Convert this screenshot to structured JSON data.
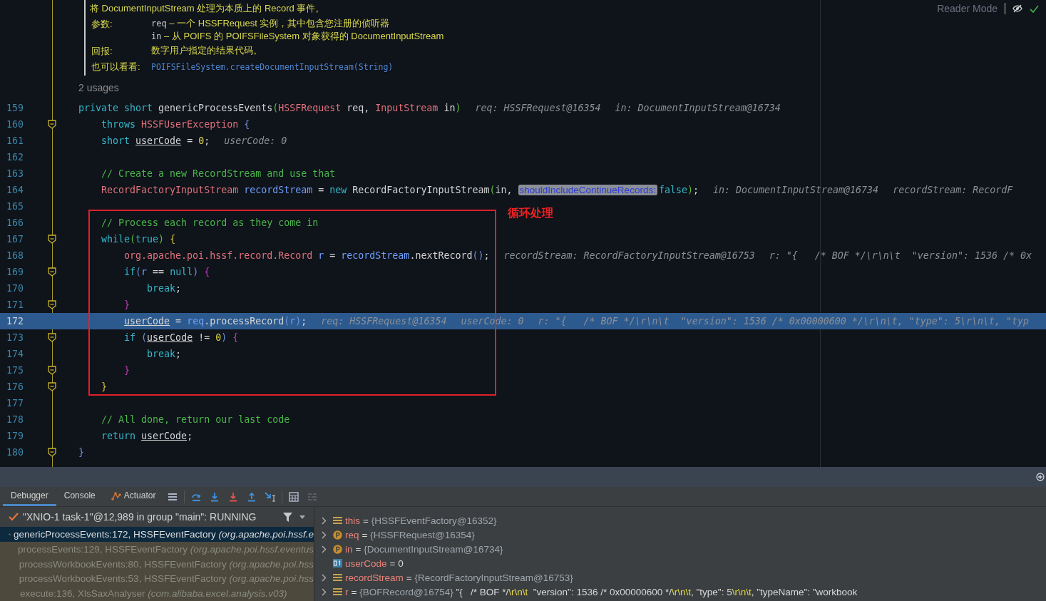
{
  "doc": {
    "summary": "将 DocumentInputStream 处理为本质上的 Record 事件。",
    "sections": [
      {
        "label": "参数:",
        "items": [
          {
            "code": "req",
            "text": " – 一个 HSSFRequest 实例，其中包含您注册的侦听器"
          },
          {
            "code": "in",
            "text": " – 从 POIFS 的 POIFSFileSystem 对象获得的 DocumentInputStream"
          }
        ]
      },
      {
        "label": "回报:",
        "items": [
          {
            "text": "数字用户指定的结果代码。"
          }
        ]
      },
      {
        "label": "也可以看看:",
        "items": [
          {
            "link": "POIFSFileSystem.createDocumentInputStream(String)"
          }
        ]
      }
    ]
  },
  "reader_mode": {
    "label": "Reader Mode"
  },
  "usages": "2 usages",
  "blocks": [
    {
      "boxed": false,
      "lines": [
        {
          "number": "159",
          "fold": false,
          "current": false,
          "segments": [
            {
              "kind": "code",
              "tokens": [
                {
                  "t": "private short ",
                  "kind": "kw"
                },
                {
                  "t": "genericProcessEvents",
                  "kind": "id"
                },
                {
                  "t": "(",
                  "kind": "paren"
                },
                {
                  "t": "HSSFRequest",
                  "kind": "type"
                },
                {
                  "t": " req, ",
                  "kind": "id"
                },
                {
                  "t": "InputStream",
                  "kind": "type"
                },
                {
                  "t": " in",
                  "kind": "id"
                },
                {
                  "t": ")",
                  "kind": "paren"
                }
              ]
            },
            {
              "kind": "value_hint",
              "text": "req: HSSFRequest@16354"
            },
            {
              "kind": "value_hint",
              "text": "in: DocumentInputStream@16734"
            }
          ]
        },
        {
          "number": "160",
          "fold": true,
          "current": false,
          "segments": [
            {
              "kind": "code",
              "tokens": [
                {
                  "t": "    throws ",
                  "kind": "kw"
                },
                {
                  "t": "HSSFUserException",
                  "kind": "type"
                },
                {
                  "t": " {",
                  "kind": "dim"
                }
              ]
            }
          ]
        },
        {
          "number": "161",
          "fold": false,
          "current": false,
          "segments": [
            {
              "kind": "code",
              "tokens": [
                {
                  "t": "    short ",
                  "kind": "kw"
                },
                {
                  "t": "userCode",
                  "kind": "local"
                },
                {
                  "t": " = ",
                  "kind": "id"
                },
                {
                  "t": "0",
                  "kind": "num"
                },
                {
                  "t": ";",
                  "kind": "id"
                }
              ]
            },
            {
              "kind": "value_hint",
              "text": "userCode: 0"
            }
          ]
        },
        {
          "number": "162",
          "fold": false,
          "current": false
        },
        {
          "number": "163",
          "fold": false,
          "current": false,
          "segments": [
            {
              "kind": "code",
              "tokens": [
                {
                  "t": "    // Create a new RecordStream and use that",
                  "kind": "comment"
                }
              ]
            }
          ]
        },
        {
          "number": "164",
          "fold": false,
          "current": false,
          "segments": [
            {
              "kind": "code",
              "tokens": [
                {
                  "t": "    RecordFactoryInputStream",
                  "kind": "type"
                },
                {
                  "t": " recordStream",
                  "kind": "var"
                },
                {
                  "t": " = ",
                  "kind": "id"
                },
                {
                  "t": "new ",
                  "kind": "kw"
                },
                {
                  "t": "RecordFactoryInputStream",
                  "kind": "id"
                },
                {
                  "t": "(",
                  "kind": "paren"
                },
                {
                  "t": "in, ",
                  "kind": "id"
                }
              ]
            },
            {
              "kind": "param_hint",
              "text": "shouldIncludeContinueRecords:"
            },
            {
              "kind": "code",
              "tokens": [
                {
                  "t": "false",
                  "kind": "kw"
                },
                {
                  "t": ")",
                  "kind": "paren"
                },
                {
                  "t": ";",
                  "kind": "id"
                }
              ]
            },
            {
              "kind": "value_hint",
              "text": "in: DocumentInputStream@16734"
            },
            {
              "kind": "value_hint",
              "text": "recordStream: RecordF"
            }
          ]
        },
        {
          "number": "165",
          "fold": false,
          "current": false
        }
      ]
    },
    {
      "boxed": true,
      "label": "循环处理",
      "lines": [
        {
          "number": "166",
          "fold": false,
          "current": false,
          "segments": [
            {
              "kind": "code",
              "tokens": [
                {
                  "t": "    // Process each record as they come in",
                  "kind": "comment"
                }
              ]
            }
          ]
        },
        {
          "number": "167",
          "fold": true,
          "current": false,
          "segments": [
            {
              "kind": "code",
              "tokens": [
                {
                  "t": "    while",
                  "kind": "kw"
                },
                {
                  "t": "(",
                  "kind": "paren"
                },
                {
                  "t": "true",
                  "kind": "kw"
                },
                {
                  "t": ")",
                  "kind": "paren"
                },
                {
                  "t": " {",
                  "kind": "brace"
                }
              ]
            }
          ]
        },
        {
          "number": "168",
          "fold": false,
          "current": false,
          "segments": [
            {
              "kind": "code",
              "tokens": [
                {
                  "t": "        org.apache.poi.hssf.record.Record",
                  "kind": "type"
                },
                {
                  "t": " r",
                  "kind": "var"
                },
                {
                  "t": " = ",
                  "kind": "id"
                },
                {
                  "t": "recordStream",
                  "kind": "var"
                },
                {
                  "t": ".nextRecord",
                  "kind": "id"
                },
                {
                  "t": "()",
                  "kind": "dim"
                },
                {
                  "t": ";",
                  "kind": "id"
                }
              ]
            },
            {
              "kind": "value_hint",
              "text": "recordStream: RecordFactoryInputStream@16753"
            },
            {
              "kind": "value_hint",
              "text": "r: \"{   /* BOF */\\r\\n\\t  \"version\": 1536 /* 0x"
            }
          ]
        },
        {
          "number": "169",
          "fold": true,
          "current": false,
          "segments": [
            {
              "kind": "code",
              "tokens": [
                {
                  "t": "        if",
                  "kind": "kw"
                },
                {
                  "t": "(",
                  "kind": "dim"
                },
                {
                  "t": "r",
                  "kind": "var"
                },
                {
                  "t": " == ",
                  "kind": "id"
                },
                {
                  "t": "null",
                  "kind": "kw"
                },
                {
                  "t": ")",
                  "kind": "dim"
                },
                {
                  "t": " {",
                  "kind": "brace2"
                }
              ]
            }
          ]
        },
        {
          "number": "170",
          "fold": false,
          "current": false,
          "segments": [
            {
              "kind": "code",
              "tokens": [
                {
                  "t": "            break",
                  "kind": "kw"
                },
                {
                  "t": ";",
                  "kind": "id"
                }
              ]
            }
          ]
        },
        {
          "number": "171",
          "fold": true,
          "current": false,
          "segments": [
            {
              "kind": "code",
              "tokens": [
                {
                  "t": "        }",
                  "kind": "brace2"
                }
              ]
            }
          ]
        },
        {
          "number": "172",
          "fold": false,
          "current": true,
          "segments": [
            {
              "kind": "code",
              "tokens": [
                {
                  "t": "        userCode",
                  "kind": "local"
                },
                {
                  "t": " = ",
                  "kind": "id"
                },
                {
                  "t": "req",
                  "kind": "var"
                },
                {
                  "t": ".processRecord",
                  "kind": "id"
                },
                {
                  "t": "(",
                  "kind": "dim"
                },
                {
                  "t": "r",
                  "kind": "var"
                },
                {
                  "t": ")",
                  "kind": "dim"
                },
                {
                  "t": ";",
                  "kind": "id"
                }
              ]
            },
            {
              "kind": "value_hint",
              "text": "req: HSSFRequest@16354"
            },
            {
              "kind": "value_hint",
              "text": "userCode: 0"
            },
            {
              "kind": "value_hint",
              "text": "r: \"{   /* BOF */\\r\\n\\t  \"version\": 1536 /* 0x00000600 */\\r\\n\\t, \"type\": 5\\r\\n\\t, \"typ"
            }
          ]
        },
        {
          "number": "173",
          "fold": true,
          "current": false,
          "segments": [
            {
              "kind": "code",
              "tokens": [
                {
                  "t": "        if ",
                  "kind": "kw"
                },
                {
                  "t": "(",
                  "kind": "dim"
                },
                {
                  "t": "userCode",
                  "kind": "local"
                },
                {
                  "t": " != ",
                  "kind": "id"
                },
                {
                  "t": "0",
                  "kind": "num"
                },
                {
                  "t": ")",
                  "kind": "dim"
                },
                {
                  "t": " {",
                  "kind": "brace2"
                }
              ]
            }
          ]
        },
        {
          "number": "174",
          "fold": false,
          "current": false,
          "segments": [
            {
              "kind": "code",
              "tokens": [
                {
                  "t": "            break",
                  "kind": "kw"
                },
                {
                  "t": ";",
                  "kind": "id"
                }
              ]
            }
          ]
        },
        {
          "number": "175",
          "fold": true,
          "current": false,
          "segments": [
            {
              "kind": "code",
              "tokens": [
                {
                  "t": "        }",
                  "kind": "brace2"
                }
              ]
            }
          ]
        },
        {
          "number": "176",
          "fold": true,
          "current": false,
          "segments": [
            {
              "kind": "code",
              "tokens": [
                {
                  "t": "    }",
                  "kind": "brace"
                }
              ]
            }
          ]
        }
      ]
    },
    {
      "boxed": false,
      "lines": [
        {
          "number": "177",
          "fold": false,
          "current": false
        },
        {
          "number": "178",
          "fold": false,
          "current": false,
          "segments": [
            {
              "kind": "code",
              "tokens": [
                {
                  "t": "    // All done, return our last code",
                  "kind": "comment"
                }
              ]
            }
          ]
        },
        {
          "number": "179",
          "fold": false,
          "current": false,
          "segments": [
            {
              "kind": "code",
              "tokens": [
                {
                  "t": "    return ",
                  "kind": "kw"
                },
                {
                  "t": "userCode",
                  "kind": "local"
                },
                {
                  "t": ";",
                  "kind": "id"
                }
              ]
            }
          ]
        },
        {
          "number": "180",
          "fold": true,
          "current": false,
          "segments": [
            {
              "kind": "code",
              "tokens": [
                {
                  "t": "}",
                  "kind": "dim"
                }
              ]
            }
          ]
        }
      ]
    }
  ],
  "debugger": {
    "tabs": [
      {
        "label": "Debugger",
        "selected": true,
        "kind": "plain"
      },
      {
        "label": "Console",
        "selected": false,
        "kind": "plain"
      },
      {
        "label": "Actuator",
        "selected": false,
        "kind": "actuator"
      }
    ],
    "tools": [
      {
        "kind": "menu",
        "disabled": false
      },
      {
        "kind": "step_over",
        "disabled": false
      },
      {
        "kind": "step_into",
        "disabled": false
      },
      {
        "kind": "force_step_into",
        "disabled": false
      },
      {
        "kind": "step_out",
        "disabled": false
      },
      {
        "kind": "run_to_cursor",
        "disabled": false
      },
      {
        "kind": "evaluate",
        "disabled": false
      },
      {
        "kind": "trace",
        "disabled": true
      }
    ],
    "thread": "\"XNIO-1 task-1\"@12,989 in group \"main\": RUNNING",
    "frames": [
      {
        "text": "genericProcessEvents:172, HSSFEventFactory *(org.apache.poi.hssf.e*",
        "selected": true,
        "library": false
      },
      {
        "text": "processEvents:129, HSSFEventFactory *(org.apache.poi.hssf.eventus*",
        "selected": false,
        "library": true
      },
      {
        "text": "processWorkbookEvents:80, HSSFEventFactory *(org.apache.poi.hss*",
        "selected": false,
        "library": true
      },
      {
        "text": "processWorkbookEvents:53, HSSFEventFactory *(org.apache.poi.hss*",
        "selected": false,
        "library": true
      },
      {
        "text": "execute:136, XlsSaxAnalyser *(com.alibaba.excel.analysis.v03)*",
        "selected": false,
        "library": true
      }
    ],
    "variables": [
      {
        "name": "this",
        "kind": "field",
        "expandable": true,
        "value": [
          {
            "t": "= ",
            "kind": "plain"
          },
          {
            "t": "{HSSFEventFactory@16352}",
            "kind": "ref"
          }
        ]
      },
      {
        "name": "req",
        "kind": "param",
        "expandable": true,
        "value": [
          {
            "t": "= ",
            "kind": "plain"
          },
          {
            "t": "{HSSFRequest@16354}",
            "kind": "ref"
          }
        ]
      },
      {
        "name": "in",
        "kind": "param",
        "expandable": true,
        "value": [
          {
            "t": "= ",
            "kind": "plain"
          },
          {
            "t": "{DocumentInputStream@16734}",
            "kind": "ref"
          }
        ]
      },
      {
        "name": "userCode",
        "kind": "primitive",
        "expandable": false,
        "value": [
          {
            "t": "= 0",
            "kind": "plain"
          }
        ]
      },
      {
        "name": "recordStream",
        "kind": "field",
        "expandable": true,
        "value": [
          {
            "t": "= ",
            "kind": "plain"
          },
          {
            "t": "{RecordFactoryInputStream@16753}",
            "kind": "ref"
          }
        ]
      },
      {
        "name": "r",
        "kind": "field",
        "expandable": true,
        "value": [
          {
            "t": "= ",
            "kind": "plain"
          },
          {
            "t": "{BOFRecord@16754} ",
            "kind": "ref"
          },
          {
            "t": "\"{   /* BOF */",
            "kind": "plain"
          },
          {
            "t": "\\r\\n\\t",
            "kind": "escape"
          },
          {
            "t": "  \"version\": 1536 /* 0x00000600 */",
            "kind": "plain"
          },
          {
            "t": "\\r\\n\\t",
            "kind": "escape"
          },
          {
            "t": ", \"type\": 5",
            "kind": "plain"
          },
          {
            "t": "\\r\\n\\t",
            "kind": "escape"
          },
          {
            "t": ", \"typeName\": \"workbook",
            "kind": "plain"
          }
        ]
      }
    ]
  }
}
